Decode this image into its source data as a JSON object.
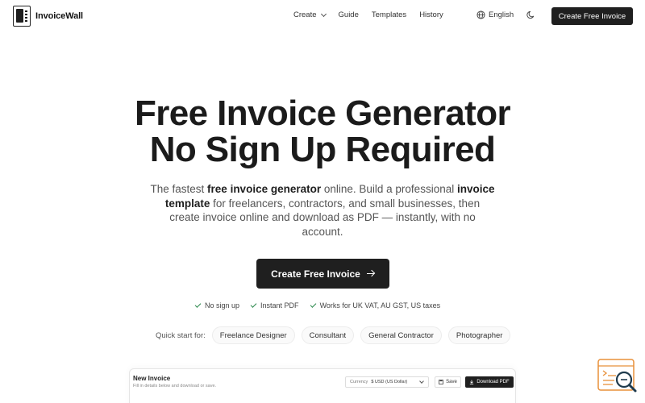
{
  "nav": {
    "brand": "InvoiceWall",
    "links": [
      {
        "label": "Create",
        "has_dropdown": true
      },
      {
        "label": "Guide"
      },
      {
        "label": "Templates"
      },
      {
        "label": "History"
      }
    ],
    "language": "English",
    "cta": "Create Free Invoice",
    "icons": {
      "logo": "invoice-logo-icon",
      "language": "globe-icon",
      "theme": "moon-icon"
    }
  },
  "hero": {
    "title_line1": "Free Invoice Generator",
    "title_line2": "No Sign Up Required",
    "subtitle": {
      "p1": "The fastest ",
      "b1": "free invoice generator",
      "p2": " online. Build a professional ",
      "b2": "invoice template",
      "p3": " for freelancers, contractors, and small businesses, then create invoice online and download as PDF — instantly, with no account."
    },
    "cta": "Create Free Invoice",
    "checks": [
      "No sign up",
      "Instant PDF",
      "Works for UK VAT, AU GST, US taxes"
    ],
    "quick_start": {
      "label": "Quick start for:",
      "chips": [
        "Freelance Designer",
        "Consultant",
        "General Contractor",
        "Photographer"
      ]
    }
  },
  "preview": {
    "title": "New Invoice",
    "subtitle": "Fill in details below and download or save.",
    "currency_label": "Currency",
    "currency_value": "$ USD (US Dollar)",
    "save_label": "Save",
    "download_label": "Download PDF"
  },
  "colors": {
    "primary": "#1f1f1f",
    "check": "#2d8a4e",
    "badge": "#e8903a",
    "badge_dark": "#1f3b4d"
  }
}
